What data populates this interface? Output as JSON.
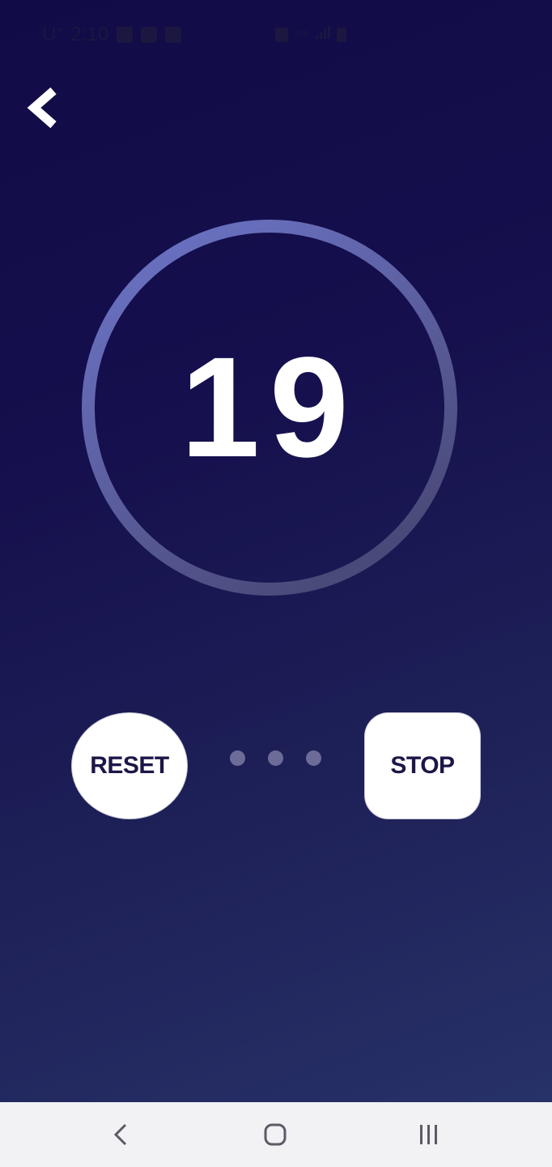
{
  "status_bar": {
    "carrier": "U",
    "carrier_sup": "+",
    "time": "2:10",
    "network": "LTE",
    "icons": [
      "image-icon",
      "bag-icon",
      "sim-icon",
      "mute-icon",
      "signal-icon",
      "battery-charging-icon"
    ]
  },
  "header": {
    "back_icon": "chevron-left-icon"
  },
  "timer": {
    "value": "19",
    "ring_color_top": "#6c75c9",
    "ring_color_bottom": "#4a4a7a"
  },
  "controls": {
    "reset_label": "RESET",
    "stop_label": "STOP",
    "dots": 3
  },
  "nav_bar": {
    "back_icon": "nav-back-icon",
    "home_icon": "nav-home-icon",
    "recents_icon": "nav-recents-icon"
  },
  "colors": {
    "background_start": "#110b47",
    "background_end": "#273268",
    "button_text": "#1c1747",
    "dot": "#6d6b97"
  }
}
